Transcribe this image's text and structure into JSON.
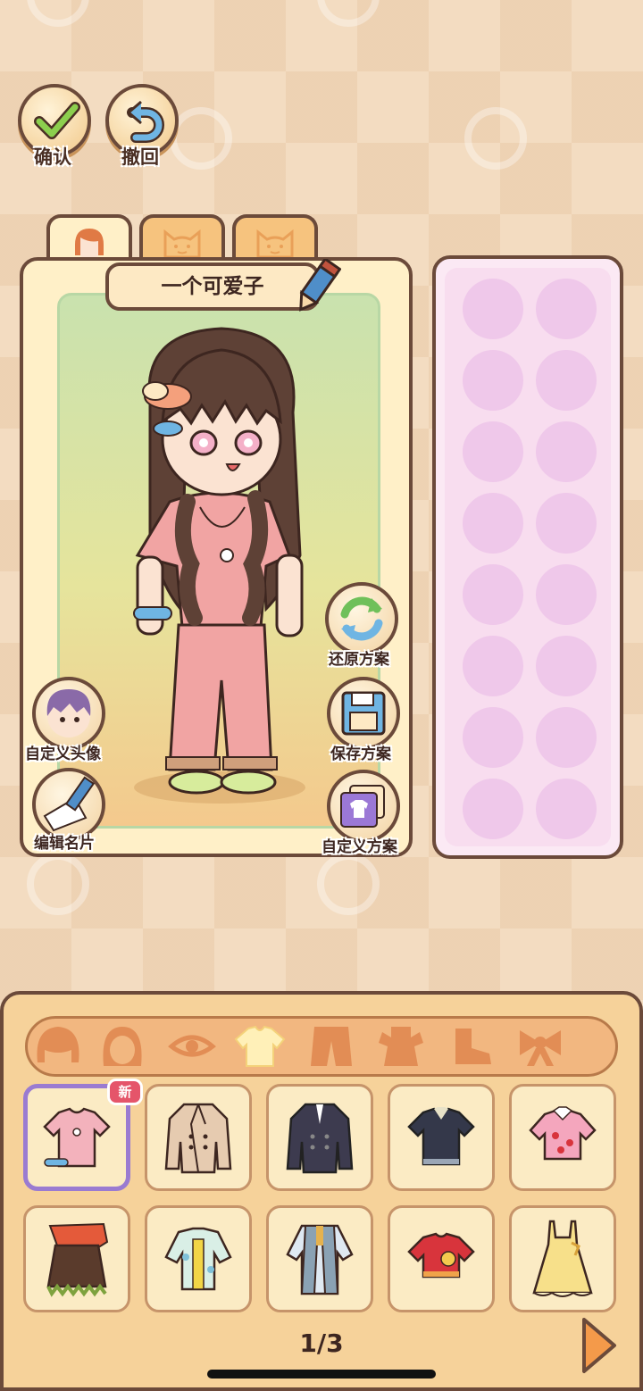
{
  "top_buttons": {
    "confirm_label": "确认",
    "undo_label": "撤回"
  },
  "tabs": [
    {
      "icon": "girl-face-icon",
      "active": true
    },
    {
      "icon": "cat-face-icon",
      "active": false
    },
    {
      "icon": "cat-face-icon",
      "active": false
    }
  ],
  "character": {
    "name": "一个可爱子"
  },
  "side_actions": {
    "custom_avatar": "自定义头像",
    "edit_card": "编辑名片",
    "restore_plan": "还原方案",
    "save_plan": "保存方案",
    "custom_plan": "自定义方案"
  },
  "outfit_slots_count": 16,
  "categories": [
    {
      "name": "hair-icon"
    },
    {
      "name": "face-icon"
    },
    {
      "name": "eye-icon"
    },
    {
      "name": "top-icon",
      "active": true
    },
    {
      "name": "pants-icon"
    },
    {
      "name": "dress-icon"
    },
    {
      "name": "shoes-icon"
    },
    {
      "name": "bow-icon"
    }
  ],
  "items": [
    {
      "name": "pink-tshirt-item",
      "selected": true,
      "badge": "新",
      "color": "#f3b2bc"
    },
    {
      "name": "beige-trench-coat-item",
      "color": "#e6cbb0"
    },
    {
      "name": "navy-coat-item",
      "color": "#3d3b4f"
    },
    {
      "name": "navy-polo-item",
      "color": "#34384a"
    },
    {
      "name": "strawberry-shirt-item",
      "color": "#f4a6bd"
    },
    {
      "name": "brown-skirt-scarf-item",
      "color": "#5a3b2c"
    },
    {
      "name": "floral-shirt-item",
      "color": "#d9efe6"
    },
    {
      "name": "grey-vest-jacket-item",
      "color": "#8aa2b4"
    },
    {
      "name": "red-apple-top-item",
      "color": "#d8343c"
    },
    {
      "name": "yellow-dress-item",
      "color": "#f7e08a"
    }
  ],
  "pagination": {
    "text": "1/3"
  }
}
